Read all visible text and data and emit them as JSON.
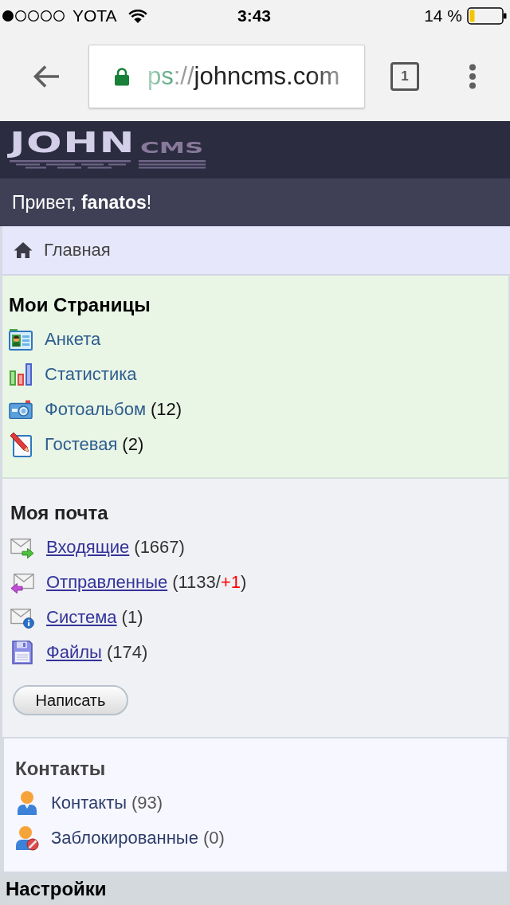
{
  "status_bar": {
    "carrier": "YOTA",
    "time": "3:43",
    "battery": "14 %"
  },
  "browser": {
    "url": [
      {
        "kind": "scheme",
        "text": "ps"
      },
      {
        "kind": "separator",
        "text": "://"
      },
      {
        "kind": "host",
        "text": "johncms.com"
      }
    ],
    "tab_count": "1"
  },
  "site_header": {
    "logo": {
      "main": "JOHN",
      "suffix": "CMS"
    }
  },
  "greeting": "Привет, **fanatos**!",
  "breadcrumb": {
    "label": "Главная"
  },
  "sections": [
    {
      "kind": "pages",
      "title": "Мои Страницы",
      "items": [
        {
          "label": "Анкета"
        },
        {
          "label": "Статистика"
        },
        {
          "label": "Фотоальбом",
          "count": [
            {
              "text": "(12)",
              "new": false
            }
          ]
        },
        {
          "label": "Гостевая",
          "count": [
            {
              "text": "(2)",
              "new": false
            }
          ]
        }
      ]
    },
    {
      "kind": "mail",
      "title": "Моя почта",
      "items": [
        {
          "label": "Входящие",
          "count": [
            {
              "text": "(1667)",
              "new": false
            }
          ]
        },
        {
          "label": "Отправленные",
          "count": [
            {
              "text": "(1133/",
              "new": false
            },
            {
              "text": "+1",
              "new": true
            },
            {
              "text": ")",
              "new": false
            }
          ]
        },
        {
          "label": "Система",
          "count": [
            {
              "text": "(1)",
              "new": false
            }
          ]
        },
        {
          "label": "Файлы",
          "count": [
            {
              "text": "(174)",
              "new": false
            }
          ]
        }
      ],
      "button": "Написать"
    },
    {
      "kind": "contacts",
      "title": "Контакты",
      "items": [
        {
          "label": "Контакты",
          "count": [
            {
              "text": "(93)",
              "new": false
            }
          ]
        },
        {
          "label": "Заблокированные",
          "count": [
            {
              "text": "(0)",
              "new": false
            }
          ]
        }
      ]
    },
    {
      "kind": "settings",
      "title": "Настройки"
    }
  ]
}
